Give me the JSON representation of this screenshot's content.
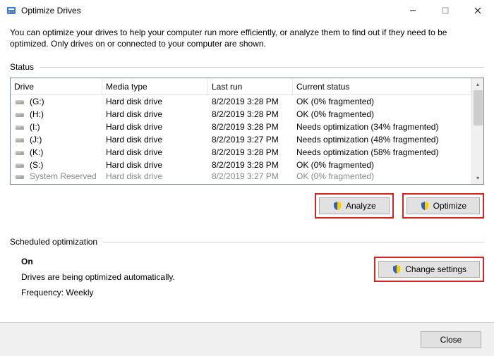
{
  "window": {
    "title": "Optimize Drives"
  },
  "intro": "You can optimize your drives to help your computer run more efficiently, or analyze them to find out if they need to be optimized. Only drives on or connected to your computer are shown.",
  "status_label": "Status",
  "columns": {
    "drive": "Drive",
    "media": "Media type",
    "last": "Last run",
    "status": "Current status"
  },
  "drives": [
    {
      "name": "(G:)",
      "media": "Hard disk drive",
      "last": "8/2/2019 3:28 PM",
      "status": "OK (0% fragmented)"
    },
    {
      "name": "(H:)",
      "media": "Hard disk drive",
      "last": "8/2/2019 3:28 PM",
      "status": "OK (0% fragmented)"
    },
    {
      "name": "(I:)",
      "media": "Hard disk drive",
      "last": "8/2/2019 3:28 PM",
      "status": "Needs optimization (34% fragmented)"
    },
    {
      "name": "(J:)",
      "media": "Hard disk drive",
      "last": "8/2/2019 3:27 PM",
      "status": "Needs optimization (48% fragmented)"
    },
    {
      "name": "(K:)",
      "media": "Hard disk drive",
      "last": "8/2/2019 3:28 PM",
      "status": "Needs optimization (58% fragmented)"
    },
    {
      "name": "(S:)",
      "media": "Hard disk drive",
      "last": "8/2/2019 3:28 PM",
      "status": "OK (0% fragmented)"
    }
  ],
  "partial": {
    "name": "System Reserved",
    "media": "Hard disk drive",
    "last": "8/2/2019 3:27 PM",
    "status": "OK (0% fragmented)"
  },
  "buttons": {
    "analyze": "Analyze",
    "optimize": "Optimize",
    "change": "Change settings",
    "close": "Close"
  },
  "sched": {
    "label": "Scheduled optimization",
    "on": "On",
    "line1": "Drives are being optimized automatically.",
    "line2": "Frequency: Weekly"
  }
}
